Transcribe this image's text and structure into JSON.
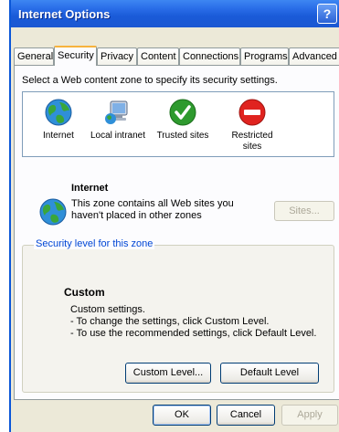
{
  "window": {
    "title": "Internet Options",
    "help_label": "?"
  },
  "tabs": [
    {
      "label": "General"
    },
    {
      "label": "Security",
      "active": true
    },
    {
      "label": "Privacy"
    },
    {
      "label": "Content"
    },
    {
      "label": "Connections"
    },
    {
      "label": "Programs"
    },
    {
      "label": "Advanced"
    }
  ],
  "security": {
    "instruction": "Select a Web content zone to specify its security settings.",
    "zones": [
      {
        "label": "Internet",
        "icon": "globe-icon",
        "selected": true
      },
      {
        "label": "Local intranet",
        "icon": "computer-globe-icon"
      },
      {
        "label": "Trusted sites",
        "icon": "check-icon"
      },
      {
        "label": "Restricted sites",
        "icon": "no-entry-icon"
      }
    ],
    "zone_info": {
      "title": "Internet",
      "description_line1": "This zone contains all Web sites you",
      "description_line2": "haven't placed in other zones",
      "sites_button": "Sites..."
    },
    "level_group": {
      "legend": "Security level for this zone",
      "level_name": "Custom",
      "lines": [
        "Custom settings.",
        "- To change the settings, click Custom Level.",
        "- To use the recommended settings, click Default Level."
      ],
      "custom_level_button": "Custom Level...",
      "default_level_button": "Default Level"
    }
  },
  "dialog_buttons": {
    "ok": "OK",
    "cancel": "Cancel",
    "apply": "Apply"
  },
  "colors": {
    "titlebar": "#2a6ee8",
    "dialog_bg": "#ece9d8",
    "active_tab_accent": "#f7b33d",
    "group_legend": "#0046d5"
  }
}
